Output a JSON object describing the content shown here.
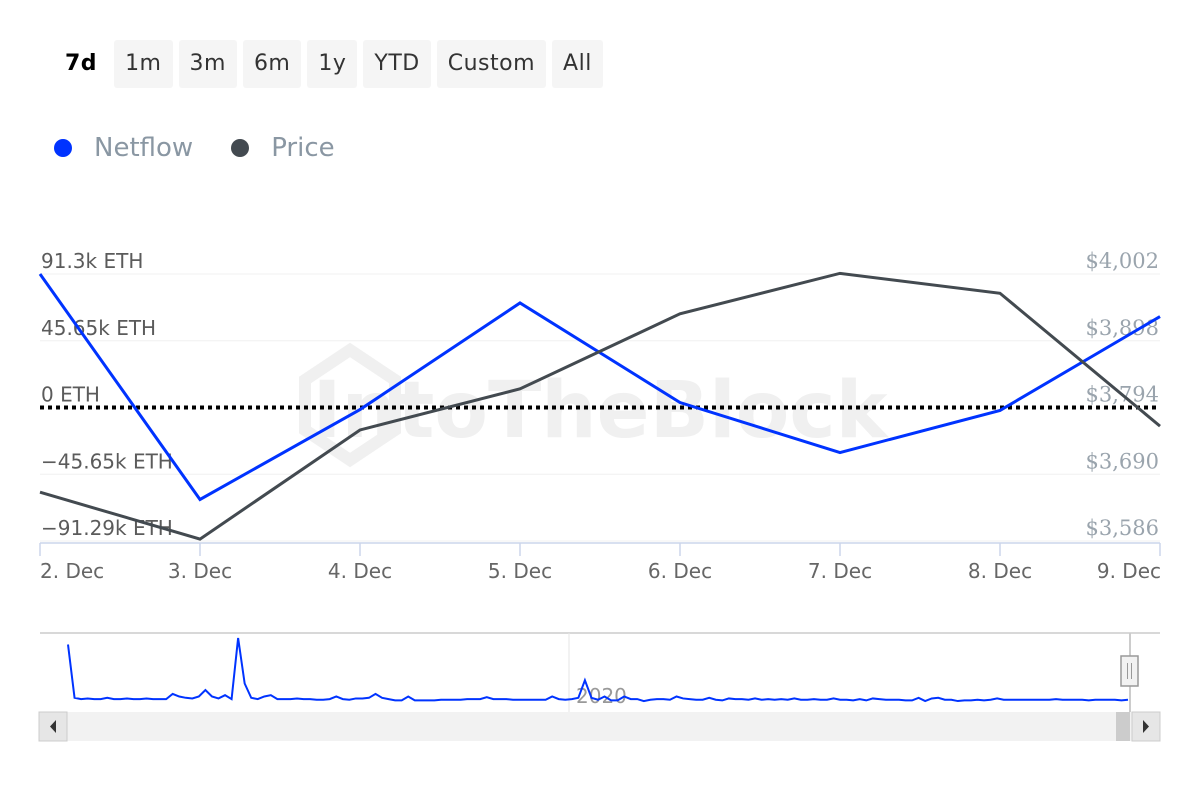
{
  "range_selector": {
    "buttons": [
      {
        "label": "7d",
        "active": true
      },
      {
        "label": "1m",
        "active": false
      },
      {
        "label": "3m",
        "active": false
      },
      {
        "label": "6m",
        "active": false
      },
      {
        "label": "1y",
        "active": false
      },
      {
        "label": "YTD",
        "active": false
      },
      {
        "label": "Custom",
        "active": false
      },
      {
        "label": "All",
        "active": false
      }
    ]
  },
  "legend": {
    "items": [
      {
        "label": "Netflow",
        "color": "#0033ff"
      },
      {
        "label": "Price",
        "color": "#434a50"
      }
    ]
  },
  "watermark": "IntoTheBlock",
  "navigator": {
    "year_label": "2020"
  },
  "chart_data": {
    "type": "line",
    "title": "",
    "x": [
      "2. Dec",
      "3. Dec",
      "4. Dec",
      "5. Dec",
      "6. Dec",
      "7. Dec",
      "8. Dec",
      "9. Dec"
    ],
    "series": [
      {
        "name": "Netflow",
        "axis": "left",
        "color": "#0033ff",
        "unit": "ETH",
        "values": [
          91300,
          -62900,
          -1400,
          71500,
          3400,
          -30800,
          -2000,
          62200
        ]
      },
      {
        "name": "Price",
        "axis": "right",
        "color": "#434a50",
        "unit": "USD",
        "values": [
          3662,
          3589,
          3759,
          3823,
          3940,
          4003,
          3972,
          3765
        ]
      }
    ],
    "y_left": {
      "ticks": [
        91300,
        45650,
        0,
        -45650,
        -91290
      ],
      "tick_labels": [
        "91.3k ETH",
        "45.65k ETH",
        "0 ETH",
        "-45.65k ETH",
        "-91.29k ETH"
      ],
      "range": [
        -91290,
        91300
      ]
    },
    "y_right": {
      "ticks": [
        4002,
        3898,
        3794,
        3690,
        3586
      ],
      "tick_labels": [
        "$4,002",
        "$3,898",
        "$3,794",
        "$3,690",
        "$3,586"
      ],
      "range": [
        3586,
        4002
      ]
    },
    "zero_line": {
      "value": 0,
      "style": "dotted"
    },
    "grid": true,
    "legend_position": "top-left",
    "navigator_series": [
      0.9,
      0.08,
      0.06,
      0.07,
      0.06,
      0.06,
      0.08,
      0.06,
      0.06,
      0.07,
      0.06,
      0.06,
      0.07,
      0.06,
      0.06,
      0.06,
      0.14,
      0.1,
      0.08,
      0.07,
      0.1,
      0.2,
      0.1,
      0.07,
      0.12,
      0.06,
      1.0,
      0.3,
      0.08,
      0.06,
      0.1,
      0.12,
      0.06,
      0.06,
      0.06,
      0.07,
      0.06,
      0.06,
      0.05,
      0.05,
      0.06,
      0.1,
      0.06,
      0.05,
      0.07,
      0.07,
      0.08,
      0.14,
      0.08,
      0.06,
      0.04,
      0.04,
      0.1,
      0.04,
      0.04,
      0.04,
      0.04,
      0.05,
      0.05,
      0.05,
      0.05,
      0.06,
      0.06,
      0.06,
      0.09,
      0.06,
      0.06,
      0.06,
      0.05,
      0.05,
      0.05,
      0.05,
      0.05,
      0.05,
      0.1,
      0.06,
      0.05,
      0.06,
      0.08,
      0.35,
      0.08,
      0.05,
      0.1,
      0.04,
      0.04,
      0.1,
      0.06,
      0.06,
      0.03,
      0.05,
      0.06,
      0.06,
      0.05,
      0.1,
      0.07,
      0.06,
      0.05,
      0.05,
      0.08,
      0.05,
      0.04,
      0.07,
      0.06,
      0.06,
      0.05,
      0.07,
      0.05,
      0.06,
      0.05,
      0.06,
      0.05,
      0.07,
      0.05,
      0.05,
      0.06,
      0.05,
      0.05,
      0.07,
      0.05,
      0.05,
      0.04,
      0.06,
      0.04,
      0.07,
      0.06,
      0.05,
      0.05,
      0.05,
      0.04,
      0.04,
      0.08,
      0.03,
      0.07,
      0.08,
      0.05,
      0.05,
      0.03,
      0.04,
      0.04,
      0.05,
      0.04,
      0.05,
      0.07,
      0.05,
      0.05,
      0.05,
      0.05,
      0.05,
      0.05,
      0.05,
      0.05,
      0.06,
      0.05,
      0.05,
      0.05,
      0.05,
      0.04,
      0.05,
      0.05,
      0.05,
      0.05,
      0.04,
      0.05
    ]
  }
}
